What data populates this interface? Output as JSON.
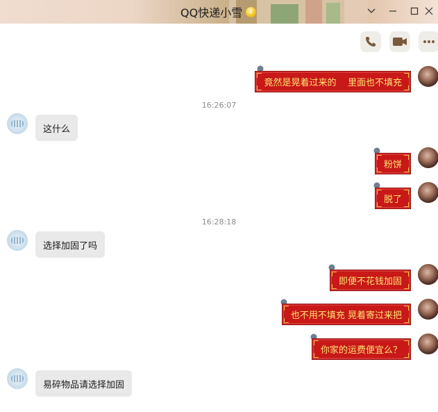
{
  "window": {
    "title": "QQ快递小雪",
    "vip_level": "2",
    "buttons": [
      "chevron-down-icon",
      "minimize-icon",
      "maximize-icon",
      "close-icon"
    ]
  },
  "toolbar": {
    "icons": [
      "phone-icon",
      "video-camera-icon",
      "more-icon"
    ],
    "accent": "#8a6a4a"
  },
  "messages": [
    {
      "side": "right",
      "text": "竟然是晃着过来的    里面也不填充"
    },
    {
      "type": "time",
      "text": "16:26:07"
    },
    {
      "side": "left",
      "text": "这什么"
    },
    {
      "side": "right",
      "text": "粉饼"
    },
    {
      "side": "right",
      "text": "脱了"
    },
    {
      "type": "time",
      "text": "16:28:18"
    },
    {
      "side": "left",
      "text": "选择加固了吗"
    },
    {
      "side": "right",
      "text": "即便不花钱加固"
    },
    {
      "side": "right",
      "text": "也不用不填充 晃着寄过来把"
    },
    {
      "side": "right",
      "text": "你家的运费便宜么？"
    },
    {
      "side": "left",
      "text": "易碎物品请选择加固"
    }
  ],
  "colors": {
    "right_bubble_bg": "#c81818",
    "right_bubble_text": "#ffe173",
    "left_bubble_bg": "#e9e9e9",
    "timestamp_text": "#8a8a8a"
  }
}
